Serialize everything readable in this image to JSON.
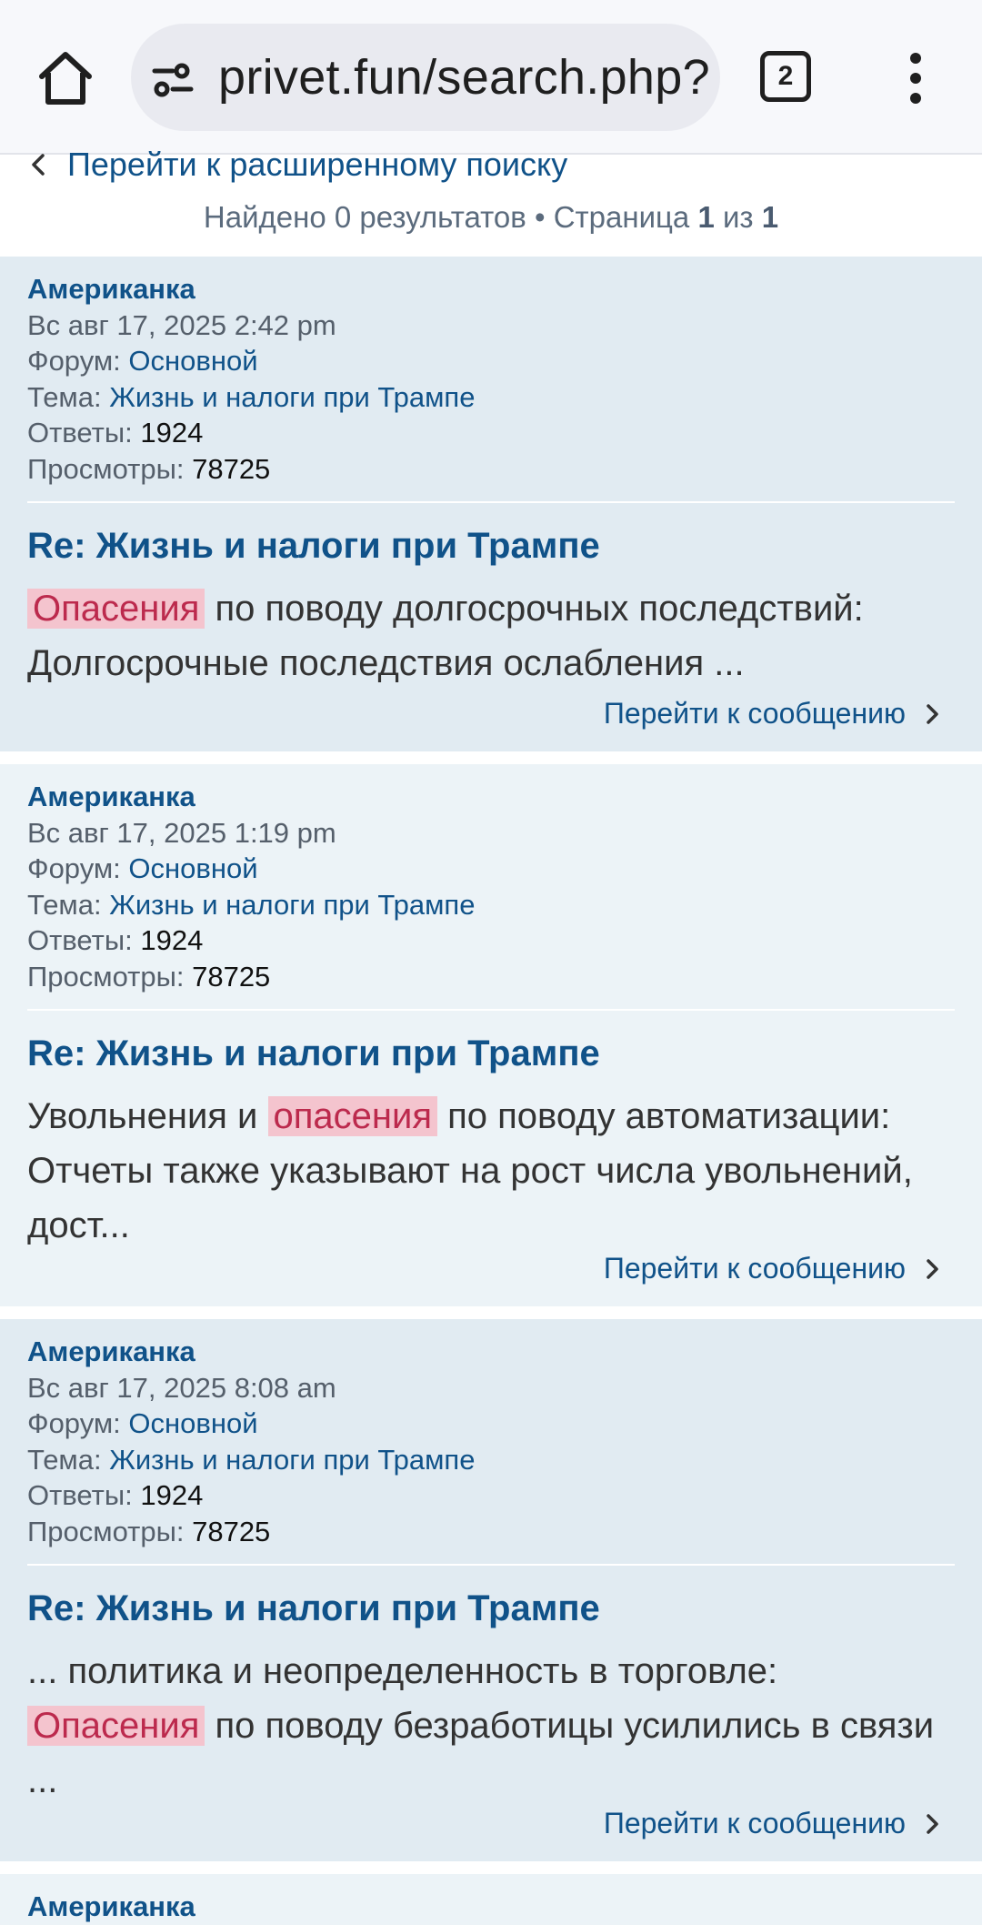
{
  "browser": {
    "url": "privet.fun/search.php?",
    "tab_count": "2"
  },
  "search": {
    "advanced_link": "Перейти к расширенному поиску",
    "found_prefix": "Найдено 0 результатов • Страница ",
    "page_current": "1",
    "page_of": " из ",
    "page_total": "1"
  },
  "labels": {
    "forum": "Форум: ",
    "topic": "Тема: ",
    "replies": "Ответы: ",
    "views": "Просмотры: ",
    "goto": "Перейти к сообщению"
  },
  "posts": [
    {
      "author": "Американка",
      "date": "Вс авг 17, 2025 2:42 pm",
      "forum": "Основной",
      "topic": "Жизнь и налоги при Трампе",
      "replies": "1924",
      "views": "78725",
      "title": "Re: Жизнь и налоги при Трампе",
      "body_before": "",
      "highlight": "Опасения",
      "body_after": " по поводу долгосрочных последствий: Долгосрочные последствия ослабления ..."
    },
    {
      "author": "Американка",
      "date": "Вс авг 17, 2025 1:19 pm",
      "forum": "Основной",
      "topic": "Жизнь и налоги при Трампе",
      "replies": "1924",
      "views": "78725",
      "title": "Re: Жизнь и налоги при Трампе",
      "body_before": "Увольнения и ",
      "highlight": "опасения",
      "body_after": " по поводу автоматизации: Отчеты также указывают на рост числа увольнений, дост..."
    },
    {
      "author": "Американка",
      "date": "Вс авг 17, 2025 8:08 am",
      "forum": "Основной",
      "topic": "Жизнь и налоги при Трампе",
      "replies": "1924",
      "views": "78725",
      "title": "Re: Жизнь и налоги при Трампе",
      "body_before": "... политика и неопределенность в торговле: ",
      "highlight": "Опасения",
      "body_after": " по поводу безработицы усилились в связи ..."
    },
    {
      "author": "Американка"
    }
  ],
  "colors": {
    "link": "#105289",
    "post_bg_1": "#e1ebf2",
    "post_bg_2": "#ecf3f7",
    "highlight_bg": "#f4c4ce",
    "highlight_text": "#bc2a4d"
  }
}
